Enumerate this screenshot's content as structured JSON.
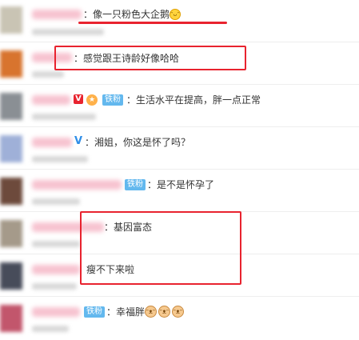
{
  "comments": [
    {
      "text": "：像一只粉色大企鹅",
      "emoji": "laugh-emoji"
    },
    {
      "text": "：感觉跟王诗龄好像哈哈"
    },
    {
      "text": "：生活水平在提高，胖一点正常",
      "badge_v": "V",
      "badge_fan": "铁粉"
    },
    {
      "text": "：湘姐，你这是怀了吗？",
      "badge_v": "V"
    },
    {
      "text": "：是不是怀孕了",
      "badge_fan": "铁粉"
    },
    {
      "text": "：基因富态"
    },
    {
      "text": "瘦不下来啦"
    },
    {
      "text": "：幸福胖",
      "badge_fan": "铁粉",
      "emoji": "cat-face-emoji"
    }
  ],
  "colors": {
    "highlight": "#e8232f",
    "fan_badge": "#63b8ee",
    "name_blur": "#f7c3d0"
  }
}
